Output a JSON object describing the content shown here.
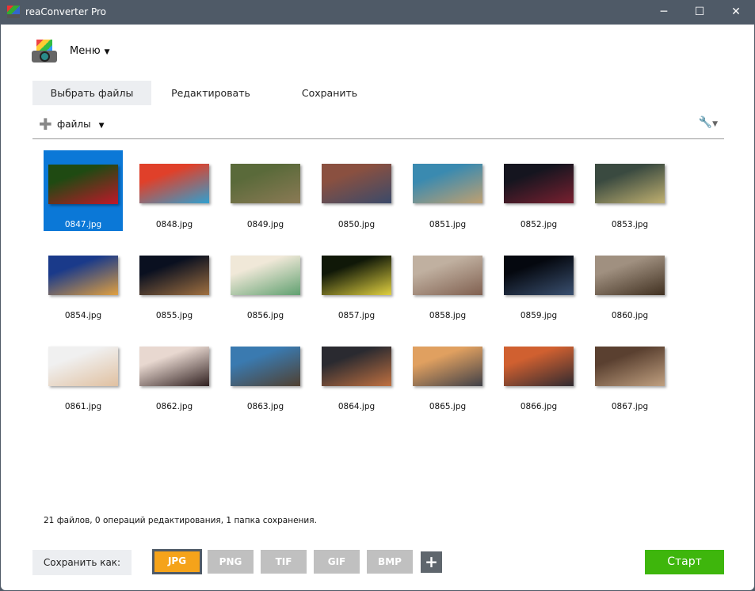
{
  "window": {
    "title": "reaConverter Pro"
  },
  "menu": {
    "label": "Меню"
  },
  "tabs": [
    {
      "label": "Выбрать файлы"
    },
    {
      "label": "Редактировать"
    },
    {
      "label": "Сохранить"
    }
  ],
  "toolbar": {
    "files_label": "файлы"
  },
  "files": [
    {
      "name": "0847.jpg",
      "colors": [
        "#1f4a12",
        "#c0182a"
      ]
    },
    {
      "name": "0848.jpg",
      "colors": [
        "#e0402a",
        "#30a0d0"
      ]
    },
    {
      "name": "0849.jpg",
      "colors": [
        "#5a6a3a",
        "#8b7a55"
      ]
    },
    {
      "name": "0850.jpg",
      "colors": [
        "#8a5040",
        "#3a4a6a"
      ]
    },
    {
      "name": "0851.jpg",
      "colors": [
        "#3a8ab0",
        "#c0a070"
      ]
    },
    {
      "name": "0852.jpg",
      "colors": [
        "#15151f",
        "#7a2030"
      ]
    },
    {
      "name": "0853.jpg",
      "colors": [
        "#3a4a40",
        "#c0b070"
      ]
    },
    {
      "name": "0854.jpg",
      "colors": [
        "#1a3a8a",
        "#e0a040"
      ]
    },
    {
      "name": "0855.jpg",
      "colors": [
        "#0a1020",
        "#a07040"
      ]
    },
    {
      "name": "0856.jpg",
      "colors": [
        "#f0e8d8",
        "#60a070"
      ]
    },
    {
      "name": "0857.jpg",
      "colors": [
        "#101808",
        "#e0d040"
      ]
    },
    {
      "name": "0858.jpg",
      "colors": [
        "#c0b0a0",
        "#806050"
      ]
    },
    {
      "name": "0859.jpg",
      "colors": [
        "#05080f",
        "#3a5070"
      ]
    },
    {
      "name": "0860.jpg",
      "colors": [
        "#a09080",
        "#403020"
      ]
    },
    {
      "name": "0861.jpg",
      "colors": [
        "#f0f0f0",
        "#e0c0a0"
      ]
    },
    {
      "name": "0862.jpg",
      "colors": [
        "#e8d8d0",
        "#302020"
      ]
    },
    {
      "name": "0863.jpg",
      "colors": [
        "#3a7ab0",
        "#504030"
      ]
    },
    {
      "name": "0864.jpg",
      "colors": [
        "#2a2a30",
        "#c07040"
      ]
    },
    {
      "name": "0865.jpg",
      "colors": [
        "#e0a060",
        "#404048"
      ]
    },
    {
      "name": "0866.jpg",
      "colors": [
        "#d06030",
        "#302a30"
      ]
    },
    {
      "name": "0867.jpg",
      "colors": [
        "#5a4030",
        "#c0a080"
      ]
    }
  ],
  "status": "21 файлов, 0 операций редактирования, 1 папка сохранения.",
  "save_as_label": "Сохранить как:",
  "formats": [
    "JPG",
    "PNG",
    "TIF",
    "GIF",
    "BMP"
  ],
  "add_format": "+",
  "start_label": "Старт"
}
